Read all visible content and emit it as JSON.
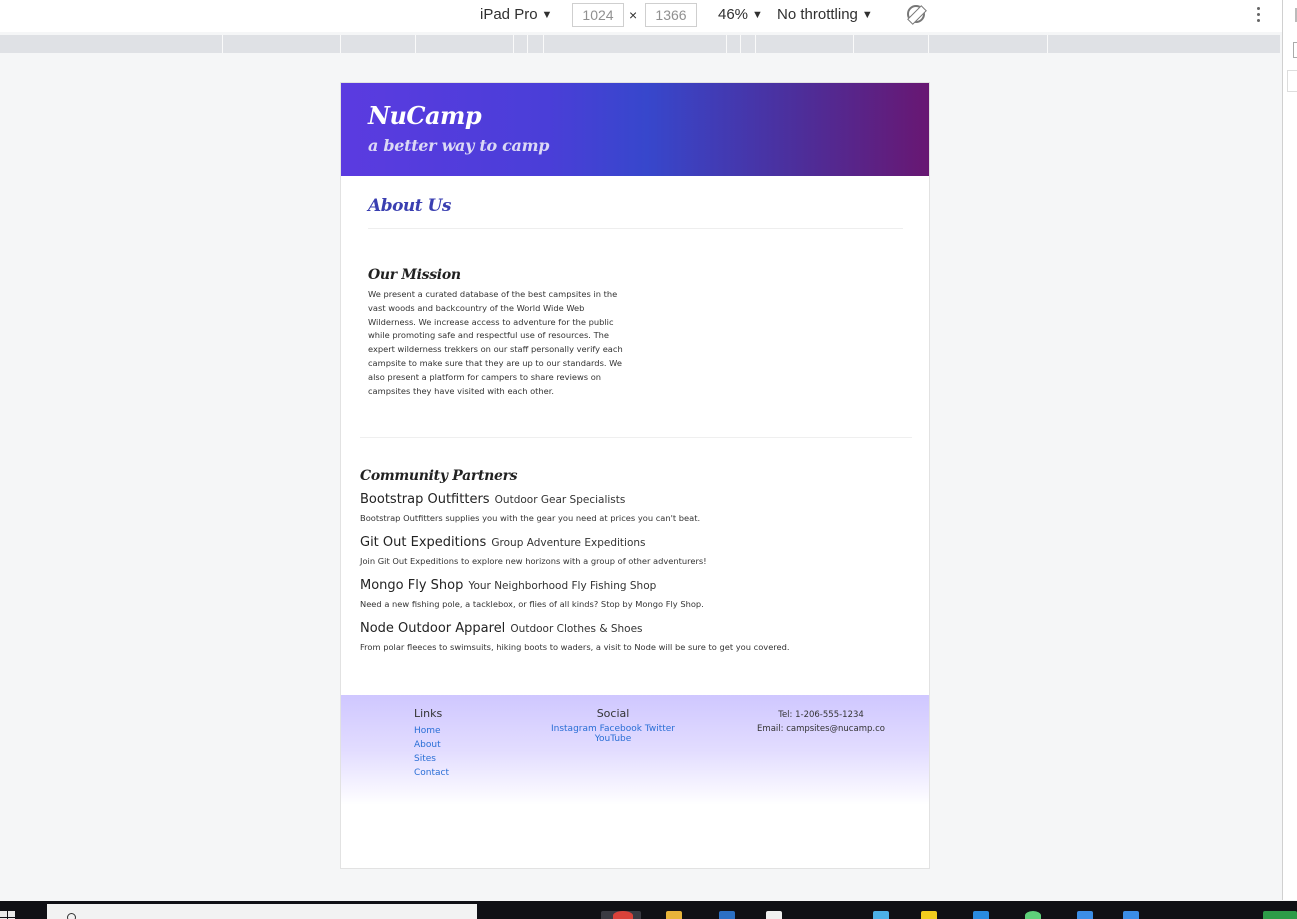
{
  "devtools": {
    "device": "iPad Pro",
    "width": "1024",
    "height": "1366",
    "times": "×",
    "zoom": "46%",
    "throttling": "No throttling"
  },
  "page": {
    "brand": "NuCamp",
    "tagline": "a better way to camp",
    "heading": "About Us",
    "mission": {
      "title": "Our Mission",
      "text": "We present a curated database of the best campsites in the vast woods and backcountry of the World Wide Web Wilderness. We increase access to adventure for the public while promoting safe and respectful use of resources. The expert wilderness trekkers on our staff personally verify each campsite to make sure that they are up to our standards. We also present a platform for campers to share reviews on campsites they have visited with each other."
    },
    "partners": {
      "title": "Community Partners",
      "items": [
        {
          "name": "Bootstrap Outfitters",
          "subtitle": "Outdoor Gear Specialists",
          "description": "Bootstrap Outfitters supplies you with the gear you need at prices you can't beat."
        },
        {
          "name": "Git Out Expeditions",
          "subtitle": "Group Adventure Expeditions",
          "description": "Join Git Out Expeditions to explore new horizons with a group of other adventurers!"
        },
        {
          "name": "Mongo Fly Shop",
          "subtitle": "Your Neighborhood Fly Fishing Shop",
          "description": "Need a new fishing pole, a tacklebox, or flies of all kinds? Stop by Mongo Fly Shop."
        },
        {
          "name": "Node Outdoor Apparel",
          "subtitle": "Outdoor Clothes & Shoes",
          "description": "From polar fleeces to swimsuits, hiking boots to waders, a visit to Node will be sure to get you covered."
        }
      ]
    },
    "footer": {
      "links_title": "Links",
      "links": [
        "Home",
        "About",
        "Sites",
        "Contact"
      ],
      "social_title": "Social",
      "social": [
        "Instagram",
        "Facebook",
        "Twitter",
        "YouTube"
      ],
      "tel": "Tel: 1-206-555-1234",
      "email": "Email: campsites@nucamp.co"
    }
  },
  "colors": {
    "header_start": "#5b3be0",
    "header_end": "#681772",
    "heading": "#3a3fb1",
    "link": "#2a6fd6",
    "footer_top": "#cfc7ff"
  },
  "icons": {
    "rotate": "rotate-icon",
    "menu": "kebab-menu-icon",
    "start": "windows-start-icon",
    "search": "search-icon"
  }
}
